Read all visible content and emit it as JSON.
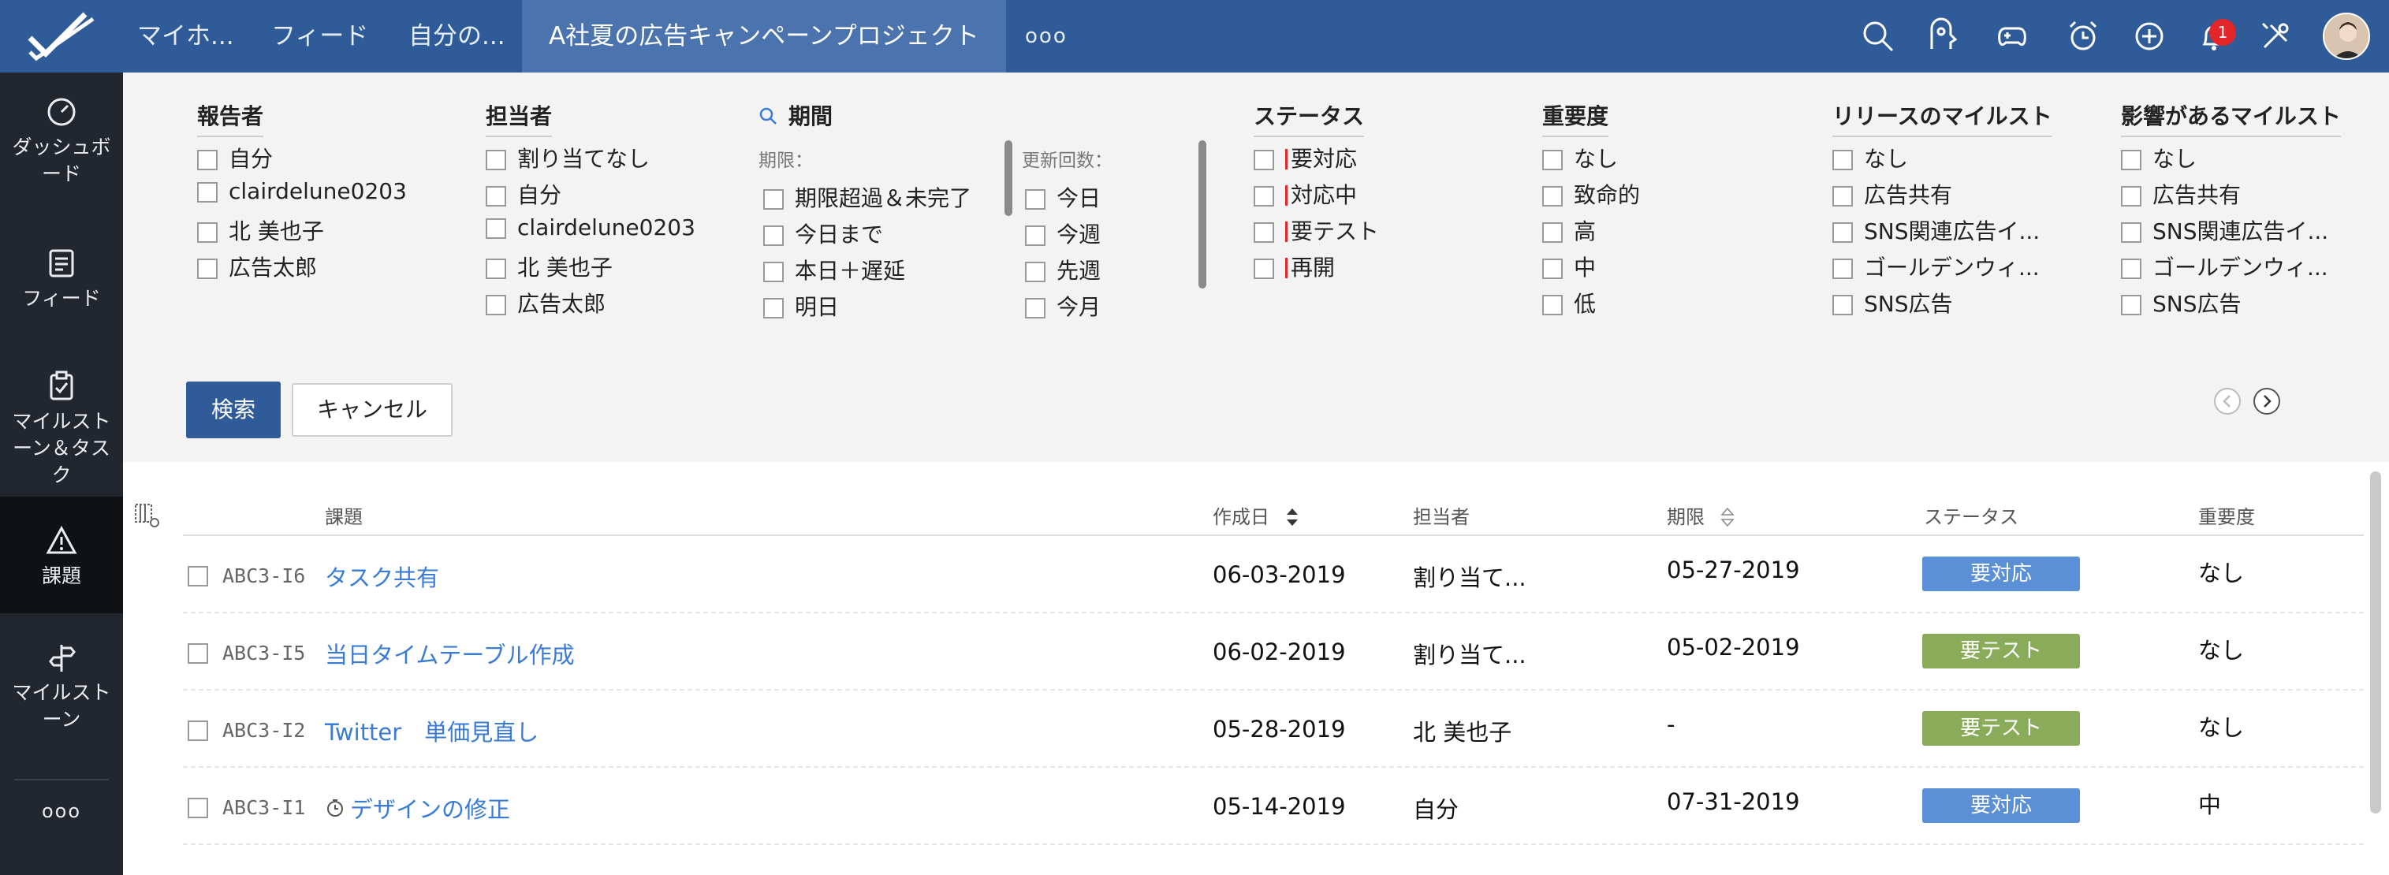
{
  "topbar": {
    "tabs": [
      "マイホ...",
      "フィード",
      "自分の...",
      "A社夏の広告キャンペーンプロジェクト"
    ],
    "more": "ooo",
    "notification_count": "1",
    "icons": [
      "search-icon",
      "feed-hand-icon",
      "game-controller-icon",
      "alarm-clock-icon",
      "add-circle-icon",
      "bell-icon",
      "tools-icon"
    ]
  },
  "sidebar": {
    "items": [
      {
        "label": "ダッシュボード",
        "icon": "dashboard-gauge-icon"
      },
      {
        "label": "フィード",
        "icon": "feed-icon"
      },
      {
        "label": "マイルストーン＆タスク",
        "icon": "clipboard-check-icon"
      },
      {
        "label": "課題",
        "icon": "warning-triangle-icon"
      },
      {
        "label": "マイルストーン",
        "icon": "signpost-icon"
      }
    ],
    "more": "ooo"
  },
  "filters": {
    "reporter": {
      "title": "報告者",
      "options": [
        "自分",
        "clairdelune0203",
        "北 美也子",
        "広告太郎"
      ]
    },
    "assignee": {
      "title": "担当者",
      "options": [
        "割り当てなし",
        "自分",
        "clairdelune0203",
        "北 美也子",
        "広告太郎"
      ]
    },
    "period": {
      "title": "期間",
      "due_label": "期限：",
      "due_options": [
        "期限超過＆未完了",
        "今日まで",
        "本日＋遅延",
        "明日"
      ],
      "update_label": "更新回数：",
      "update_options": [
        "今日",
        "今週",
        "先週",
        "今月"
      ]
    },
    "status": {
      "title": "ステータス",
      "options": [
        "要対応",
        "対応中",
        "要テスト",
        "再開"
      ]
    },
    "severity": {
      "title": "重要度",
      "options": [
        "なし",
        "致命的",
        "高",
        "中",
        "低"
      ]
    },
    "release_milestone": {
      "title": "リリースのマイルスト",
      "options": [
        "なし",
        "広告共有",
        "SNS関連広告イ...",
        "ゴールデンウィ...",
        "SNS広告"
      ]
    },
    "affected_milestone": {
      "title": "影響があるマイルスト",
      "options": [
        "なし",
        "広告共有",
        "SNS関連広告イ...",
        "ゴールデンウィ...",
        "SNS広告"
      ]
    },
    "search_button": "検索",
    "cancel_button": "キャンセル"
  },
  "table": {
    "headers": {
      "title": "課題",
      "created": "作成日",
      "assignee": "担当者",
      "due": "期限",
      "status": "ステータス",
      "severity": "重要度"
    },
    "rows": [
      {
        "key": "ABC3-I6",
        "title": "タスク共有",
        "created": "06-03-2019",
        "assignee": "割り当て...",
        "due": "05-27-2019",
        "status": "要対応",
        "severity": "なし"
      },
      {
        "key": "ABC3-I5",
        "title": "当日タイムテーブル作成",
        "created": "06-02-2019",
        "assignee": "割り当て...",
        "due": "05-02-2019",
        "status": "要テスト",
        "severity": "なし"
      },
      {
        "key": "ABC3-I2",
        "title": "Twitter　単価見直し",
        "created": "05-28-2019",
        "assignee": "北 美也子",
        "due": "-",
        "status": "要テスト",
        "severity": "なし"
      },
      {
        "key": "ABC3-I1",
        "title": "デザインの修正",
        "created": "05-14-2019",
        "assignee": "自分",
        "due": "07-31-2019",
        "status": "要対応",
        "severity": "中"
      }
    ]
  },
  "colors": {
    "topbar": "#2f5b98",
    "sidebar": "#22262e",
    "status_open": "#5b8fd6",
    "status_test": "#8aac5a",
    "link": "#3a7bd5",
    "badge": "#e2262a"
  }
}
